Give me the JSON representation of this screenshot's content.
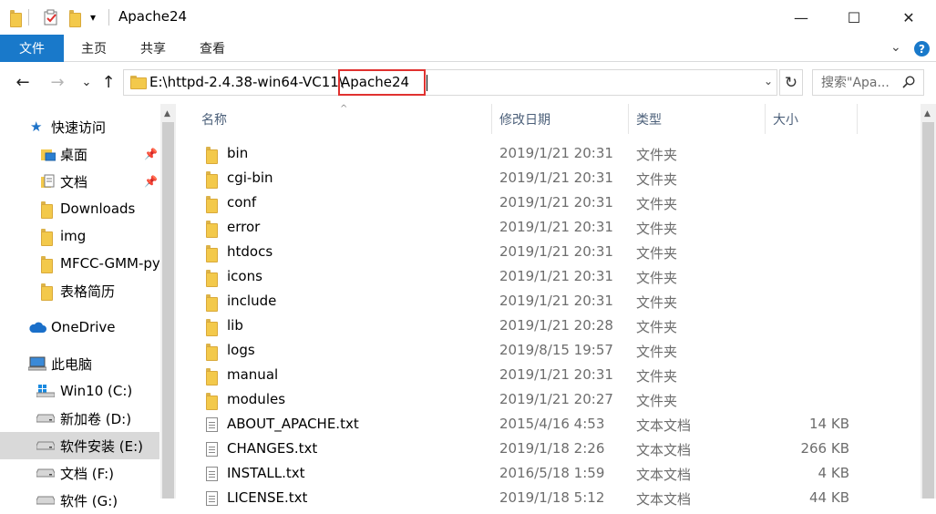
{
  "window": {
    "title": "Apache24",
    "quick_access_dropdown": "▾",
    "minimize": "—",
    "maximize": "☐",
    "close": "✕"
  },
  "ribbon": {
    "tabs": [
      "文件",
      "主页",
      "共享",
      "查看"
    ],
    "expand": "⌄",
    "help": "?"
  },
  "address": {
    "path_prefix": "E:\\httpd-2.4.38-win64-VC11\\",
    "path_selected": "Apache24",
    "dropdown": "⌄",
    "refresh": "↻",
    "search_placeholder": "搜索\"Apa...",
    "nav_back": "←",
    "nav_forward": "→",
    "nav_recent": "⌄",
    "nav_up": "↑"
  },
  "sidebar": {
    "items": [
      {
        "label": "快速访问",
        "icon": "star-icon",
        "level": 0
      },
      {
        "label": "桌面",
        "icon": "desktop-icon",
        "level": 1,
        "pinned": true
      },
      {
        "label": "文档",
        "icon": "documents-icon",
        "level": 1,
        "pinned": true
      },
      {
        "label": "Downloads",
        "icon": "folder-icon",
        "level": 1
      },
      {
        "label": "img",
        "icon": "folder-icon",
        "level": 1
      },
      {
        "label": "MFCC-GMM-py",
        "icon": "folder-icon",
        "level": 1
      },
      {
        "label": "表格简历",
        "icon": "folder-icon",
        "level": 1
      },
      {
        "label": "OneDrive",
        "icon": "cloud-icon",
        "level": 0
      },
      {
        "label": "此电脑",
        "icon": "computer-icon",
        "level": 0
      },
      {
        "label": "Win10 (C:)",
        "icon": "windows-drive-icon",
        "level": 1
      },
      {
        "label": "新加卷 (D:)",
        "icon": "drive-icon",
        "level": 1
      },
      {
        "label": "软件安装 (E:)",
        "icon": "drive-icon",
        "level": 1,
        "selected": true
      },
      {
        "label": "文档 (F:)",
        "icon": "drive-icon",
        "level": 1
      },
      {
        "label": "软件 (G:)",
        "icon": "drive-icon",
        "level": 1
      }
    ]
  },
  "columns": {
    "name": "名称",
    "date": "修改日期",
    "type": "类型",
    "size": "大小",
    "sort_indicator": "^"
  },
  "files": [
    {
      "name": "bin",
      "date": "2019/1/21 20:31",
      "type": "文件夹",
      "size": "",
      "kind": "folder"
    },
    {
      "name": "cgi-bin",
      "date": "2019/1/21 20:31",
      "type": "文件夹",
      "size": "",
      "kind": "folder"
    },
    {
      "name": "conf",
      "date": "2019/1/21 20:31",
      "type": "文件夹",
      "size": "",
      "kind": "folder"
    },
    {
      "name": "error",
      "date": "2019/1/21 20:31",
      "type": "文件夹",
      "size": "",
      "kind": "folder"
    },
    {
      "name": "htdocs",
      "date": "2019/1/21 20:31",
      "type": "文件夹",
      "size": "",
      "kind": "folder"
    },
    {
      "name": "icons",
      "date": "2019/1/21 20:31",
      "type": "文件夹",
      "size": "",
      "kind": "folder"
    },
    {
      "name": "include",
      "date": "2019/1/21 20:31",
      "type": "文件夹",
      "size": "",
      "kind": "folder"
    },
    {
      "name": "lib",
      "date": "2019/1/21 20:28",
      "type": "文件夹",
      "size": "",
      "kind": "folder"
    },
    {
      "name": "logs",
      "date": "2019/8/15 19:57",
      "type": "文件夹",
      "size": "",
      "kind": "folder"
    },
    {
      "name": "manual",
      "date": "2019/1/21 20:31",
      "type": "文件夹",
      "size": "",
      "kind": "folder"
    },
    {
      "name": "modules",
      "date": "2019/1/21 20:27",
      "type": "文件夹",
      "size": "",
      "kind": "folder"
    },
    {
      "name": "ABOUT_APACHE.txt",
      "date": "2015/4/16 4:53",
      "type": "文本文档",
      "size": "14 KB",
      "kind": "text"
    },
    {
      "name": "CHANGES.txt",
      "date": "2019/1/18 2:26",
      "type": "文本文档",
      "size": "266 KB",
      "kind": "text"
    },
    {
      "name": "INSTALL.txt",
      "date": "2016/5/18 1:59",
      "type": "文本文档",
      "size": "4 KB",
      "kind": "text"
    },
    {
      "name": "LICENSE.txt",
      "date": "2019/1/18 5:12",
      "type": "文本文档",
      "size": "44 KB",
      "kind": "text"
    }
  ],
  "colors": {
    "accent": "#1979ca",
    "highlight_box": "#e0312f",
    "selected_bg": "#d9d9d9",
    "header_text": "#4c607a",
    "secondary_text": "#6d6d6d"
  }
}
